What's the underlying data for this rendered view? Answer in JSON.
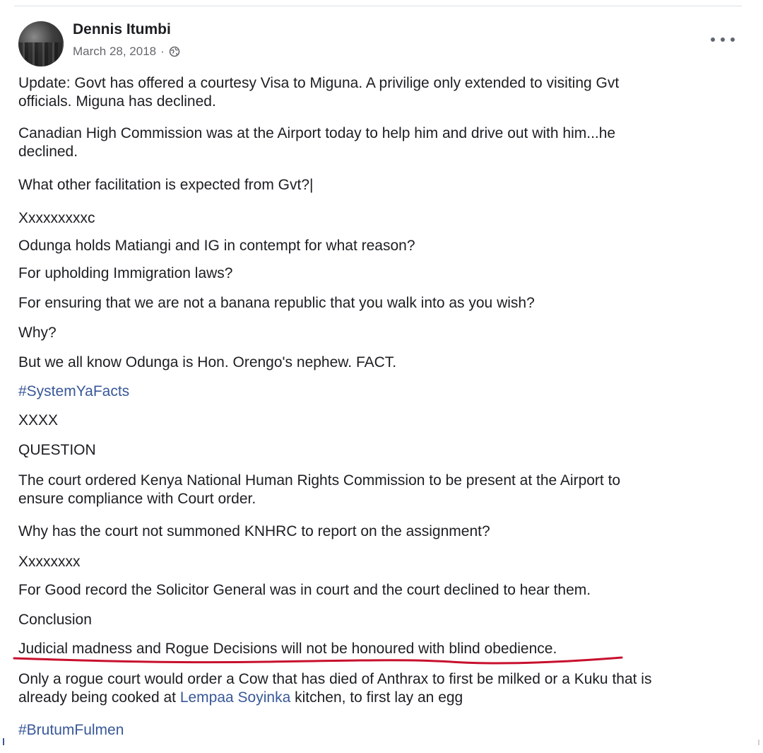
{
  "post": {
    "author": "Dennis Itumbi",
    "date": "March 28, 2018",
    "separator": "·",
    "privacy_icon": "globe-icon",
    "more_icon": "more-options-icon",
    "paragraphs": [
      {
        "line1": "Update: Govt has offered a courtesy Visa to Miguna. A privilige only extended to visiting Gvt",
        "line2": "officials. Miguna has declined."
      },
      {
        "line1": "Canadian High Commission was at the Airport today to help him and drive out with him...he",
        "line2": "declined."
      },
      {
        "line1": "What other facilitation is expected from Gvt?|"
      },
      {
        "line1": "Xxxxxxxxxc"
      },
      {
        "line1": "Odunga holds Matiangi and IG in contempt for what reason?"
      },
      {
        "line1": "For upholding Immigration laws?"
      },
      {
        "line1": "For ensuring that we are not a banana republic that you walk into as you wish?"
      },
      {
        "line1": "Why?"
      },
      {
        "line1": "But we all know Odunga is Hon. Orengo's nephew. FACT."
      },
      {
        "line1": "#SystemYaFacts"
      },
      {
        "line1": "XXXX"
      },
      {
        "line1": "QUESTION"
      },
      {
        "line1": "The court ordered Kenya National Human Rights Commission to be present at the Airport to",
        "line2": "ensure compliance with Court order."
      },
      {
        "line1": "Why has the court not summoned KNHRC to report on the assignment?"
      },
      {
        "line1": "Xxxxxxxx"
      },
      {
        "line1": "For Good record the Solicitor General was in court and the court declined to hear them."
      },
      {
        "line1": "Conclusion"
      },
      {
        "line1": "Judicial madness and Rogue Decisions will not be honoured with blind obedience."
      },
      {
        "line1": "Only a rogue court would order a Cow that has died of Anthrax to first be milked or a Kuku that is",
        "line2_pre": "already being cooked at ",
        "line2_link": "Lempaa Soyinka",
        "line2_post": " kitchen, to first lay an egg"
      },
      {
        "line1": "#BrutumFulmen"
      }
    ]
  },
  "colors": {
    "text": "#1c1e21",
    "meta": "#65676b",
    "link": "#385898",
    "underline": "#c8102e"
  }
}
